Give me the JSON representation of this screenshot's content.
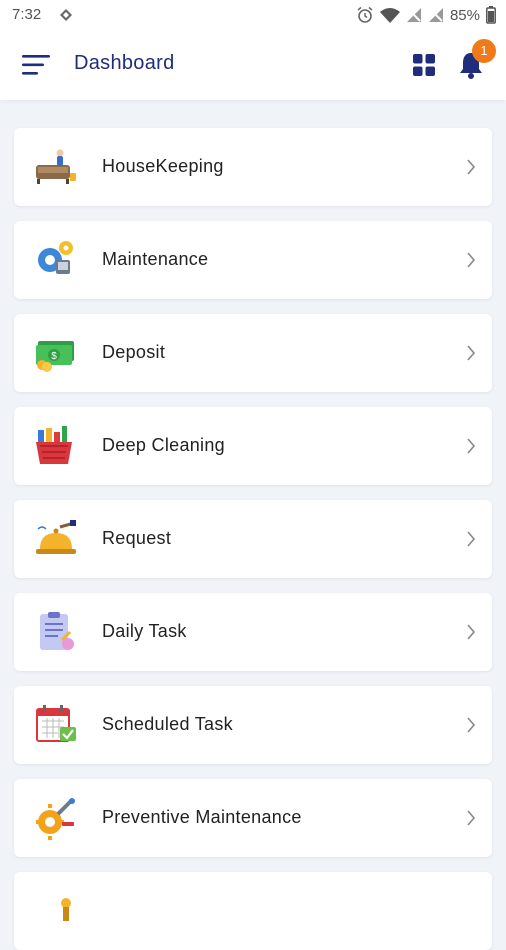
{
  "status_bar": {
    "time": "7:32",
    "battery": "85%"
  },
  "header": {
    "title": "Dashboard",
    "notification_count": "1",
    "accent_color": "#1f2d7a",
    "badge_color": "#f07a1a"
  },
  "menu_items": [
    {
      "label": "HouseKeeping",
      "icon": "housekeeping-icon"
    },
    {
      "label": "Maintenance",
      "icon": "maintenance-icon"
    },
    {
      "label": "Deposit",
      "icon": "deposit-icon"
    },
    {
      "label": "Deep Cleaning",
      "icon": "deep-cleaning-icon"
    },
    {
      "label": "Request",
      "icon": "request-bell-icon"
    },
    {
      "label": "Daily Task",
      "icon": "daily-task-icon"
    },
    {
      "label": "Scheduled Task",
      "icon": "scheduled-task-icon"
    },
    {
      "label": "Preventive Maintenance",
      "icon": "preventive-maintenance-icon"
    },
    {
      "label": "",
      "icon": "partial-item-icon"
    }
  ]
}
